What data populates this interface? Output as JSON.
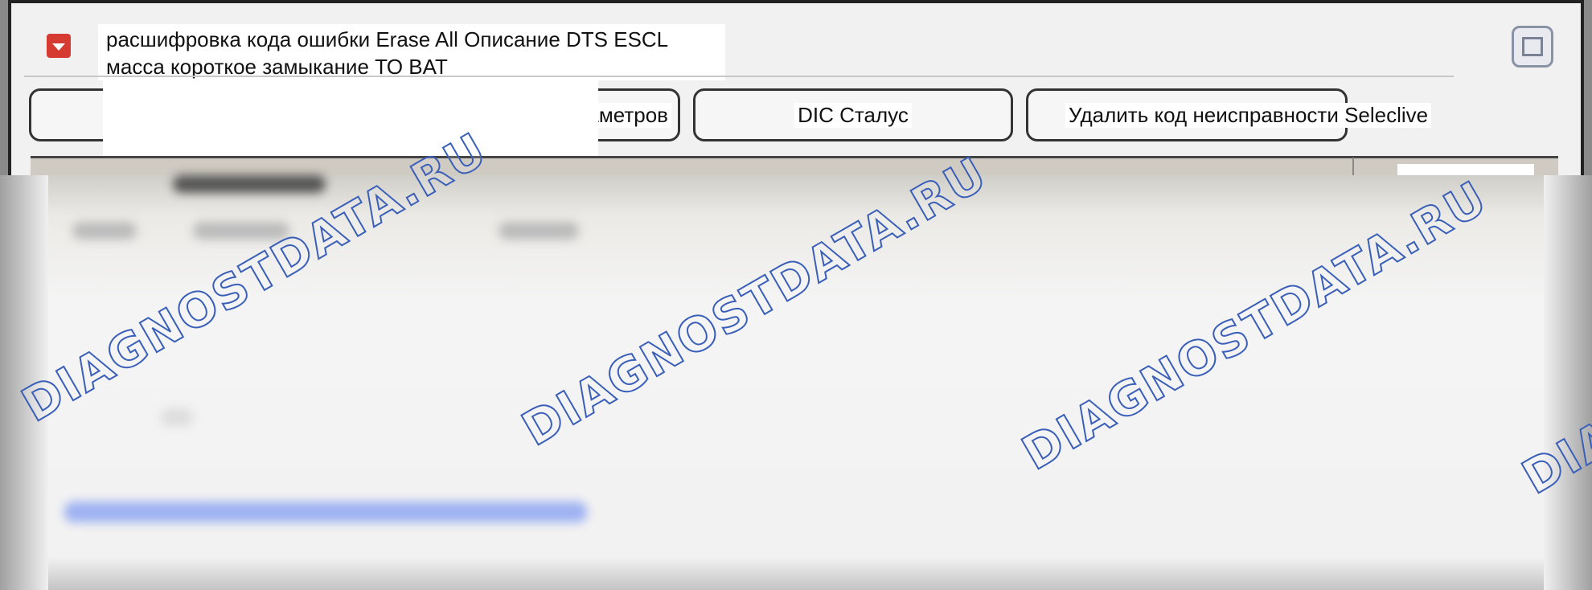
{
  "title": {
    "line1": "расшифровка кода ошибки Erase All Описание DTS ESCL",
    "line2": "масса короткое замыкание ТО BAT"
  },
  "buttons": {
    "freeze_frame": "стоп-кадр параметров",
    "dic_status": "DIC Сталус",
    "delete_code": "Удалить код неисправности Seleclive"
  },
  "watermark": {
    "text1": "DIAGNOSTDATA.RU",
    "text2": "DIAGNOSTDATA.RU",
    "text3": "DIAGNOSTDATA.RU",
    "text4": "DIAGNOSTDATA.RU"
  },
  "colors": {
    "dropdown": "#d63b32",
    "watermark": "#3a5fb8"
  },
  "icons": {
    "dropdown": "dropdown-arrow-icon",
    "maximize": "maximize-icon"
  }
}
